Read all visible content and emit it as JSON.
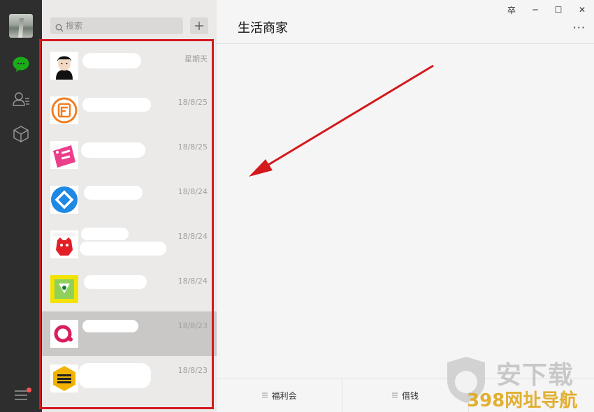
{
  "search": {
    "placeholder": "搜索"
  },
  "chats": [
    {
      "time": "星期天"
    },
    {
      "time": "18/8/25"
    },
    {
      "time": "18/8/25"
    },
    {
      "time": "18/8/24"
    },
    {
      "time": "18/8/24"
    },
    {
      "time": "18/8/24"
    },
    {
      "time": "18/8/23"
    },
    {
      "time": "18/8/23"
    }
  ],
  "chat_header": {
    "title": "生活商家",
    "more": "···"
  },
  "window_controls": {
    "pin": "卒",
    "minimize": "─",
    "maximize": "☐",
    "close": "✕"
  },
  "menu": [
    {
      "label": "福利会"
    },
    {
      "label": "借钱"
    },
    {
      "label": ""
    }
  ],
  "watermark": {
    "text": "安下载",
    "sub": "398网址导航"
  },
  "colors": {
    "annotation": "#d3191d",
    "rail": "#2e2e2e",
    "accent": "#1aad19"
  }
}
